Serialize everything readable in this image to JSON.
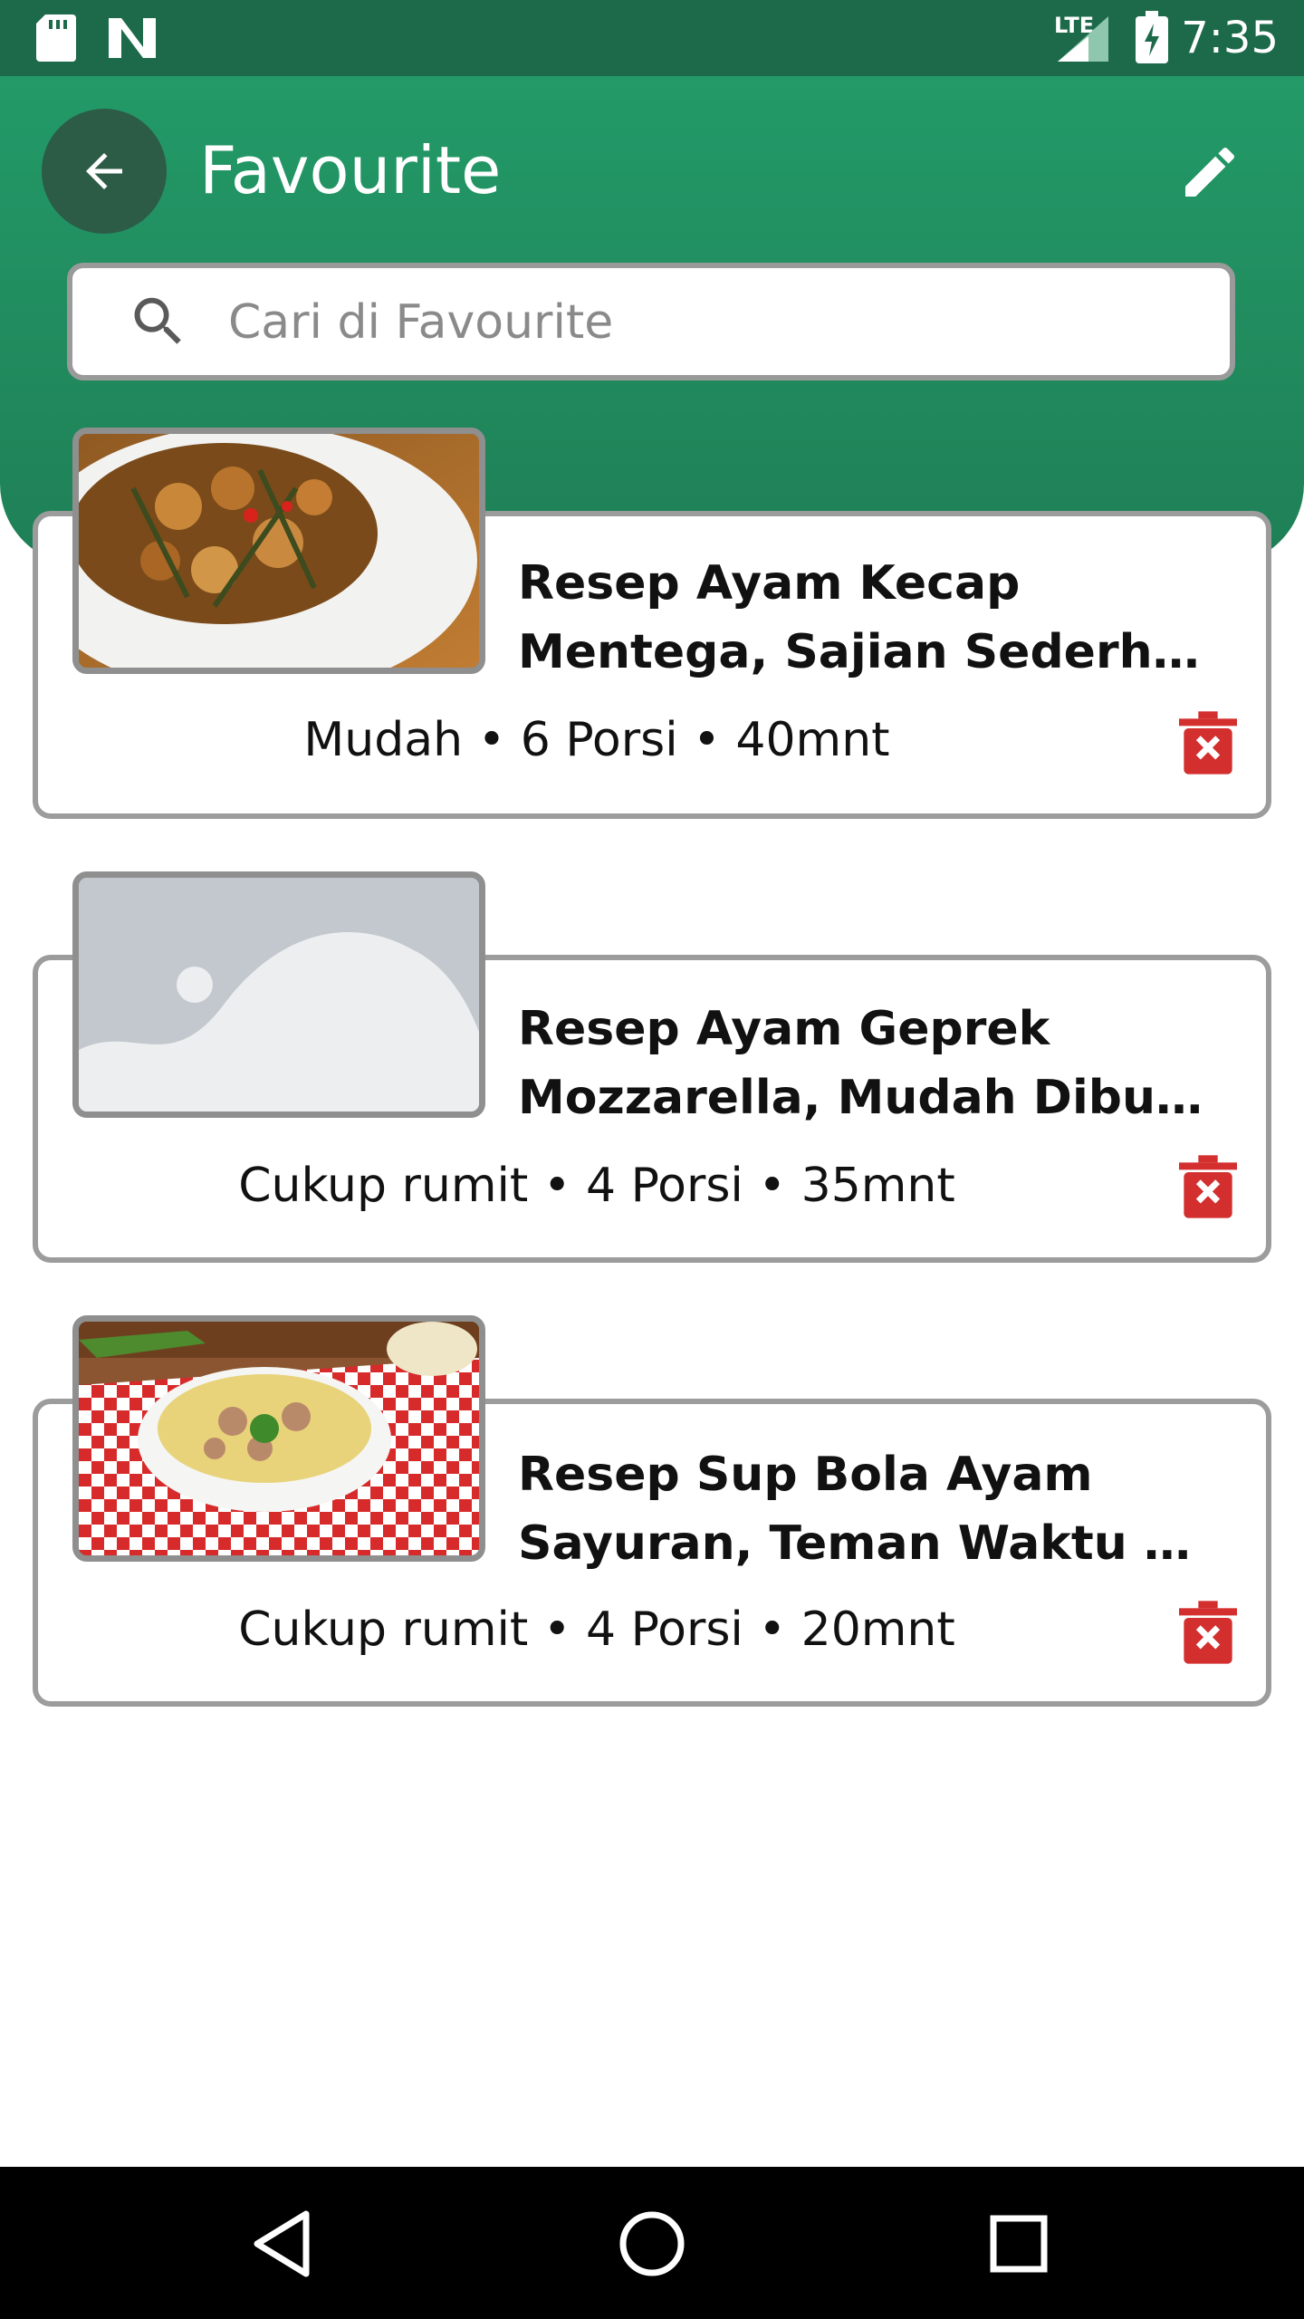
{
  "status_bar": {
    "time": "7:35",
    "network_label": "LTE",
    "icons": [
      "sd-card-icon",
      "n-notification-icon",
      "signal-icon",
      "battery-charging-icon"
    ]
  },
  "header": {
    "title": "Favourite",
    "back_icon": "arrow-left-icon",
    "edit_icon": "pencil-icon",
    "colors": {
      "primary": "#239a68",
      "status_bar": "#1d6a4a",
      "back_button": "#2c5b46"
    }
  },
  "search": {
    "placeholder": "Cari di Favourite",
    "value": ""
  },
  "recipes": [
    {
      "title_line1": "Resep Ayam Kecap",
      "title_line2": "Mentega, Sajian Sederhana",
      "difficulty": "Mudah",
      "portions": "6 Porsi",
      "time": "40mnt",
      "meta": "Mudah • 6 Porsi • 40mnt",
      "image": "chicken-dish-photo"
    },
    {
      "title_line1": "Resep Ayam Geprek",
      "title_line2": "Mozzarella, Mudah Dibuat di",
      "difficulty": "Cukup rumit",
      "portions": "4 Porsi",
      "time": "35mnt",
      "meta": "Cukup rumit • 4 Porsi • 35mnt",
      "image": "image-placeholder"
    },
    {
      "title_line1": "Resep Sup Bola Ayam",
      "title_line2": "Sayuran, Teman Waktu Santai",
      "difficulty": "Cukup rumit",
      "portions": "4 Porsi",
      "time": "20mnt",
      "meta": "Cukup rumit • 4 Porsi • 20mnt",
      "image": "soup-bowl-photo"
    }
  ],
  "delete_icon": "trash-x-icon",
  "delete_color": "#d32f2f",
  "nav_bar": {
    "buttons": [
      "back-triangle-icon",
      "home-circle-icon",
      "recents-square-icon"
    ]
  }
}
